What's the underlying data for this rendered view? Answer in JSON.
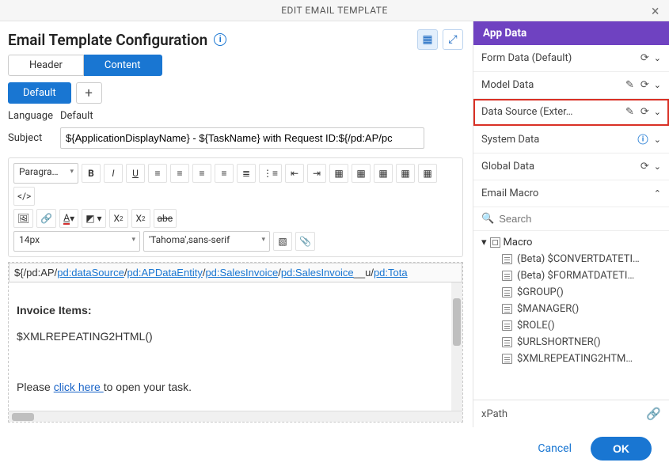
{
  "dialog": {
    "title": "EDIT EMAIL TEMPLATE"
  },
  "page": {
    "title": "Email Template Configuration"
  },
  "tabs": [
    "Header",
    "Content"
  ],
  "subtabs": [
    "Default"
  ],
  "form": {
    "language_label": "Language",
    "language_value": "Default",
    "subject_label": "Subject",
    "subject_value": "${ApplicationDisplayName} - ${TaskName} with Request ID:${/pd:AP/pc"
  },
  "toolbar": {
    "paragraph": "Paragra…",
    "font_size": "14px",
    "font_family": "'Tahoma',sans-serif"
  },
  "breadcrumb": {
    "prefix": "${/pd:AP",
    "segs": [
      "pd:dataSource",
      "pd:APDataEntity",
      "pd:SalesInvoice",
      "pd:SalesInvoice",
      "pd:Tota"
    ],
    "tail": "__u/"
  },
  "editor": {
    "heading": "Invoice Items:",
    "macro_line": "$XMLREPEATING2HTML()",
    "footer_pre": "Please ",
    "footer_link": "click here ",
    "footer_post": "to open your task."
  },
  "sidebar": {
    "title": "App Data",
    "items": [
      {
        "label": "Form Data (Default)"
      },
      {
        "label": "Model Data"
      },
      {
        "label": "Data Source (Exter…"
      },
      {
        "label": "System Data"
      },
      {
        "label": "Global Data"
      },
      {
        "label": "Email Macro"
      }
    ],
    "search_placeholder": "Search",
    "tree": {
      "root": "Macro",
      "items": [
        "(Beta) $CONVERTDATETI…",
        "(Beta) $FORMATDATETI…",
        "$GROUP()",
        "$MANAGER()",
        "$ROLE()",
        "$URLSHORTNER()",
        "$XMLREPEATING2HTM…"
      ]
    },
    "xpath_label": "xPath"
  },
  "footer": {
    "cancel": "Cancel",
    "ok": "OK"
  }
}
